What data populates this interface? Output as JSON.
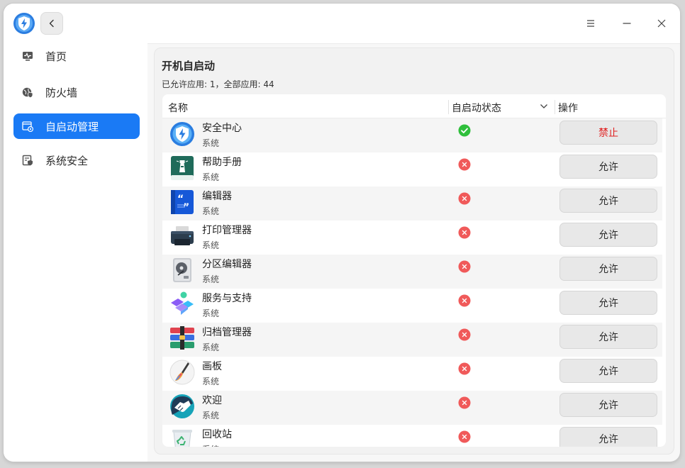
{
  "titlebar": {
    "logo_icon": "shield-bolt-icon",
    "back_icon": "chevron-left-icon",
    "menu_icon": "hamburger-icon",
    "minimize_icon": "minimize-icon",
    "close_icon": "close-icon"
  },
  "sidebar": {
    "items": [
      {
        "label": "首页",
        "icon": "monitor-pulse-icon",
        "active": false
      },
      {
        "label": "防火墙",
        "icon": "globe-shield-icon",
        "active": false
      },
      {
        "label": "自启动管理",
        "icon": "window-gear-icon",
        "active": true
      },
      {
        "label": "系统安全",
        "icon": "doc-shield-icon",
        "active": false
      }
    ]
  },
  "main": {
    "title": "开机自启动",
    "summary": "已允许应用: 1，全部应用: 44",
    "columns": {
      "name": "名称",
      "status": "自启动状态",
      "ops": "操作"
    },
    "rows": [
      {
        "name": "安全中心",
        "type": "系统",
        "enabled": true,
        "action": "禁止",
        "icon": "security-center-icon"
      },
      {
        "name": "帮助手册",
        "type": "系统",
        "enabled": false,
        "action": "允许",
        "icon": "help-manual-icon"
      },
      {
        "name": "编辑器",
        "type": "系统",
        "enabled": false,
        "action": "允许",
        "icon": "editor-icon"
      },
      {
        "name": "打印管理器",
        "type": "系统",
        "enabled": false,
        "action": "允许",
        "icon": "printer-icon"
      },
      {
        "name": "分区编辑器",
        "type": "系统",
        "enabled": false,
        "action": "允许",
        "icon": "disk-icon"
      },
      {
        "name": "服务与支持",
        "type": "系统",
        "enabled": false,
        "action": "允许",
        "icon": "service-support-icon"
      },
      {
        "name": "归档管理器",
        "type": "系统",
        "enabled": false,
        "action": "允许",
        "icon": "archive-icon"
      },
      {
        "name": "画板",
        "type": "系统",
        "enabled": false,
        "action": "允许",
        "icon": "paint-brush-icon"
      },
      {
        "name": "欢迎",
        "type": "系统",
        "enabled": false,
        "action": "允许",
        "icon": "handshake-icon"
      },
      {
        "name": "回收站",
        "type": "系统",
        "enabled": false,
        "action": "允许",
        "icon": "recycle-bin-icon"
      }
    ]
  },
  "colors": {
    "accent": "#1a7af5",
    "enabled": "#2fbf3c",
    "disabled": "#f05a5a",
    "deny_text": "#e02020"
  }
}
